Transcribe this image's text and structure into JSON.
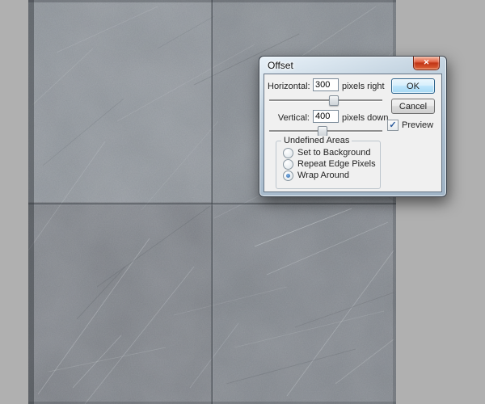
{
  "dialog": {
    "title": "Offset",
    "close_glyph": "✕",
    "fields": {
      "horizontal": {
        "label": "Horizontal:",
        "value": "300",
        "unit": "pixels right",
        "slider_pos": "57%"
      },
      "vertical": {
        "label": "Vertical:",
        "value": "400",
        "unit": "pixels down",
        "slider_pos": "47%"
      }
    },
    "buttons": {
      "ok": "OK",
      "cancel": "Cancel"
    },
    "preview": {
      "label": "Preview",
      "checked": true,
      "glyph": "✓"
    },
    "undefined_areas": {
      "title": "Undefined Areas",
      "options": [
        {
          "label": "Set to Background",
          "selected": false
        },
        {
          "label": "Repeat Edge Pixels",
          "selected": false
        },
        {
          "label": "Wrap Around",
          "selected": true
        }
      ]
    },
    "colors": {
      "ok_button_tint": "#bde5fc",
      "close_button_red": "#c13415",
      "selection_blue": "#2f66a8",
      "dialog_frame": "#a9bccd"
    }
  }
}
